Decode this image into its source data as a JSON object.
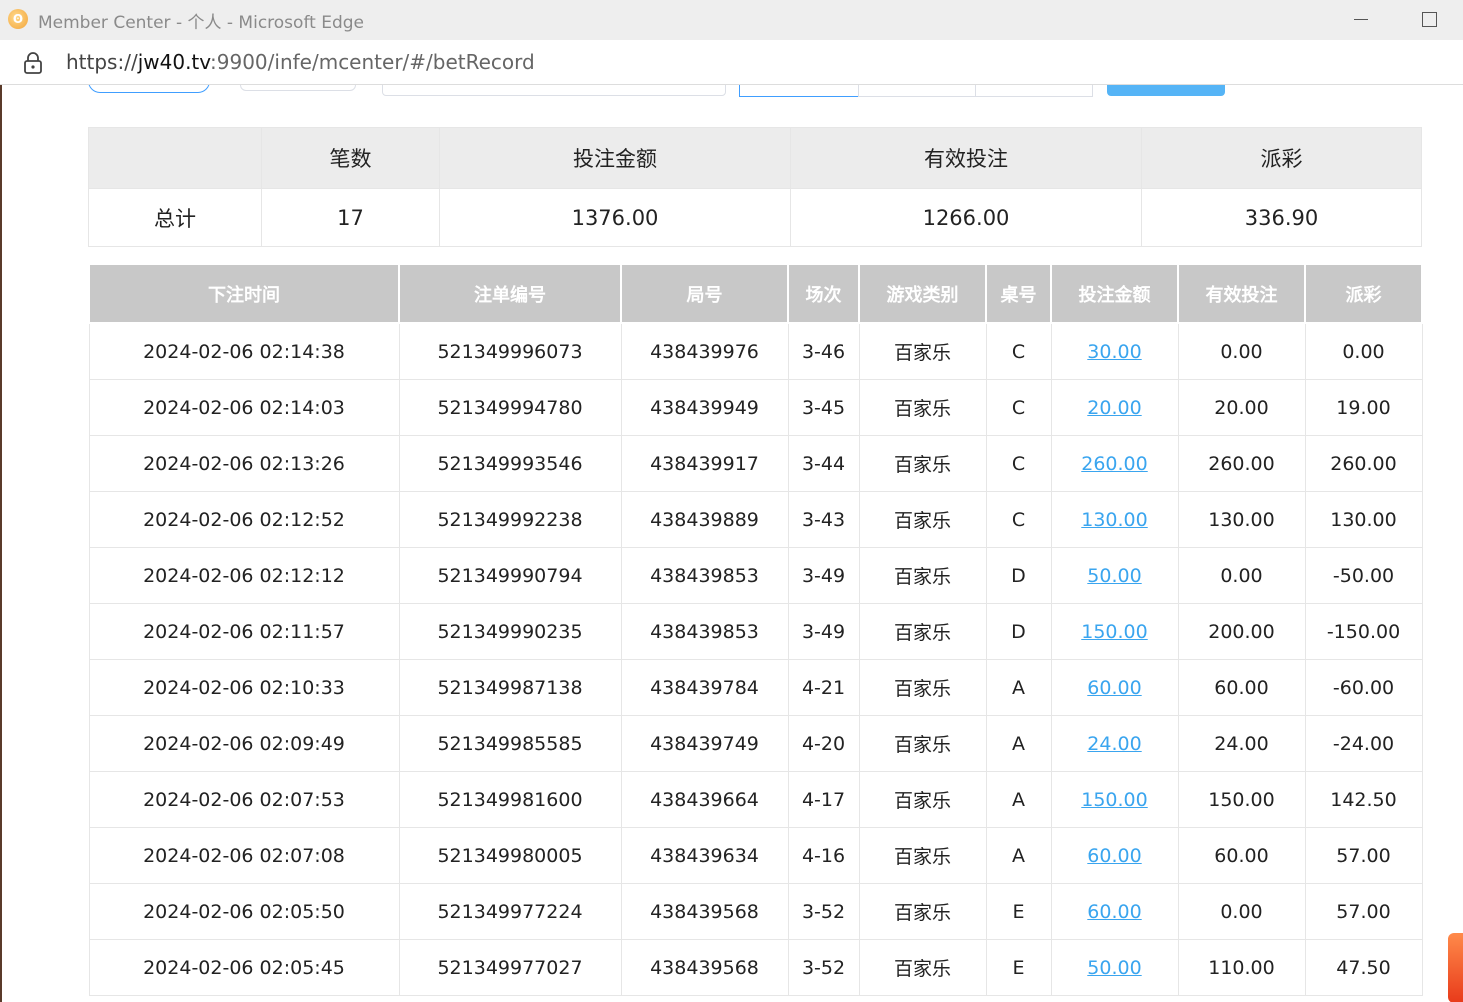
{
  "window": {
    "title": "Member Center - 个人 - Microsoft Edge",
    "url_prefix": "https://",
    "url_host": "jw40.tv",
    "url_rest": ":9900/infe/mcenter/#/betRecord"
  },
  "summary": {
    "headers": [
      "",
      "笔数",
      "投注金额",
      "有效投注",
      "派彩"
    ],
    "row": {
      "label": "总计",
      "count": "17",
      "bet_amount": "1376.00",
      "valid_bet": "1266.00",
      "payout": "336.90"
    }
  },
  "records": {
    "headers": [
      "下注时间",
      "注单编号",
      "局号",
      "场次",
      "游戏类别",
      "桌号",
      "投注金额",
      "有效投注",
      "派彩"
    ],
    "rows": [
      {
        "time": "2024-02-06 02:14:38",
        "order_no": "521349996073",
        "round_no": "438439976",
        "session": "3-46",
        "game": "百家乐",
        "table": "C",
        "bet": "30.00",
        "valid": "0.00",
        "payout": "0.00",
        "negative": false
      },
      {
        "time": "2024-02-06 02:14:03",
        "order_no": "521349994780",
        "round_no": "438439949",
        "session": "3-45",
        "game": "百家乐",
        "table": "C",
        "bet": "20.00",
        "valid": "20.00",
        "payout": "19.00",
        "negative": false
      },
      {
        "time": "2024-02-06 02:13:26",
        "order_no": "521349993546",
        "round_no": "438439917",
        "session": "3-44",
        "game": "百家乐",
        "table": "C",
        "bet": "260.00",
        "valid": "260.00",
        "payout": "260.00",
        "negative": false
      },
      {
        "time": "2024-02-06 02:12:52",
        "order_no": "521349992238",
        "round_no": "438439889",
        "session": "3-43",
        "game": "百家乐",
        "table": "C",
        "bet": "130.00",
        "valid": "130.00",
        "payout": "130.00",
        "negative": false
      },
      {
        "time": "2024-02-06 02:12:12",
        "order_no": "521349990794",
        "round_no": "438439853",
        "session": "3-49",
        "game": "百家乐",
        "table": "D",
        "bet": "50.00",
        "valid": "0.00",
        "payout": "-50.00",
        "negative": true
      },
      {
        "time": "2024-02-06 02:11:57",
        "order_no": "521349990235",
        "round_no": "438439853",
        "session": "3-49",
        "game": "百家乐",
        "table": "D",
        "bet": "150.00",
        "valid": "200.00",
        "payout": "-150.00",
        "negative": true
      },
      {
        "time": "2024-02-06 02:10:33",
        "order_no": "521349987138",
        "round_no": "438439784",
        "session": "4-21",
        "game": "百家乐",
        "table": "A",
        "bet": "60.00",
        "valid": "60.00",
        "payout": "-60.00",
        "negative": true
      },
      {
        "time": "2024-02-06 02:09:49",
        "order_no": "521349985585",
        "round_no": "438439749",
        "session": "4-20",
        "game": "百家乐",
        "table": "A",
        "bet": "24.00",
        "valid": "24.00",
        "payout": "-24.00",
        "negative": true
      },
      {
        "time": "2024-02-06 02:07:53",
        "order_no": "521349981600",
        "round_no": "438439664",
        "session": "4-17",
        "game": "百家乐",
        "table": "A",
        "bet": "150.00",
        "valid": "150.00",
        "payout": "142.50",
        "negative": false
      },
      {
        "time": "2024-02-06 02:07:08",
        "order_no": "521349980005",
        "round_no": "438439634",
        "session": "4-16",
        "game": "百家乐",
        "table": "A",
        "bet": "60.00",
        "valid": "60.00",
        "payout": "57.00",
        "negative": false
      },
      {
        "time": "2024-02-06 02:05:50",
        "order_no": "521349977224",
        "round_no": "438439568",
        "session": "3-52",
        "game": "百家乐",
        "table": "E",
        "bet": "60.00",
        "valid": "0.00",
        "payout": "57.00",
        "negative": false
      },
      {
        "time": "2024-02-06 02:05:45",
        "order_no": "521349977027",
        "round_no": "438439568",
        "session": "3-52",
        "game": "百家乐",
        "table": "E",
        "bet": "50.00",
        "valid": "110.00",
        "payout": "47.50",
        "negative": false
      }
    ]
  },
  "colors": {
    "link": "#3aa5ef",
    "negative": "#ee3344",
    "header_bg": "#c8c8c8",
    "summary_header_bg": "#ececec"
  }
}
